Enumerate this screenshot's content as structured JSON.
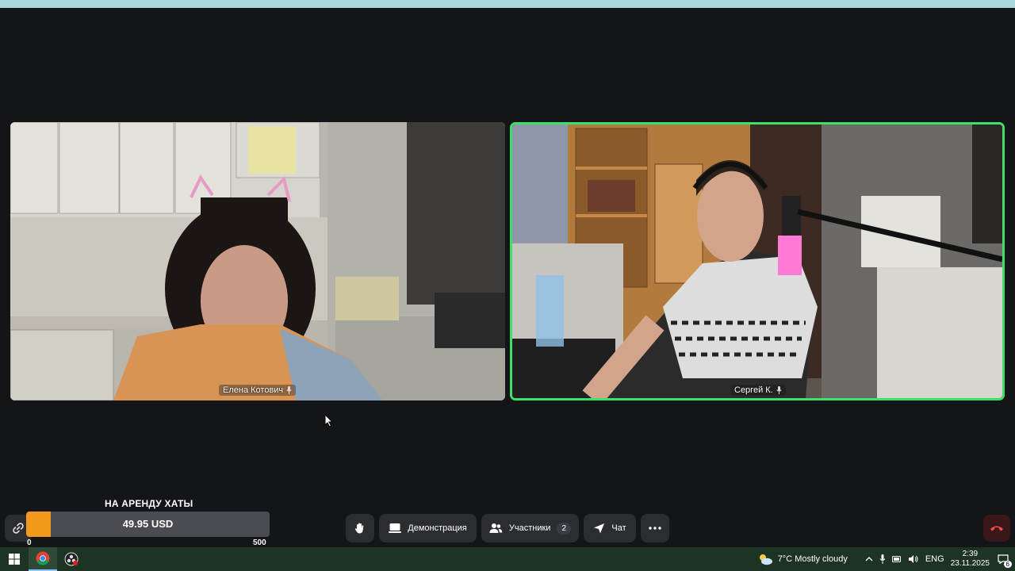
{
  "participants": [
    {
      "name": "Елена Котович"
    },
    {
      "name": "Сергей К."
    }
  ],
  "donation": {
    "title": "НА АРЕНДУ ХАТЫ",
    "amount": "49.95 USD",
    "min": "0",
    "max": "500",
    "progress_fraction": 0.0999,
    "accent_color": "#f39a1d"
  },
  "controls": {
    "raise_hand_icon": "hand-icon",
    "demo_label": "Демонстрация",
    "participants_label": "Участники",
    "participants_count": "2",
    "chat_label": "Чат",
    "more_icon": "more-icon",
    "leave_icon": "phone-hangup-icon",
    "leave_color": "#ff4d4d"
  },
  "active_speaker_color": "#3ee06a",
  "taskbar": {
    "weather": "7°C  Mostly cloudy",
    "lang": "ENG",
    "time": "2:39",
    "date": "23.11.2025",
    "notifications": "6"
  }
}
